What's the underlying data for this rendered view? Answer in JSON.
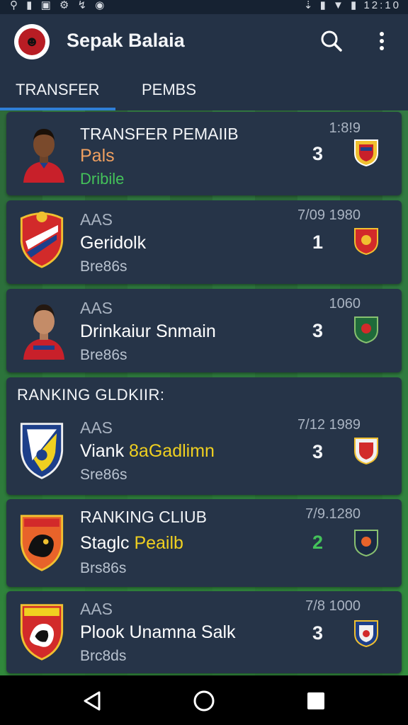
{
  "status_bar": {
    "left_icons": "⚲ ▮ ▣ ⚙ ↯ ◉",
    "right_icons": "⇣ ▮ ▼ ▮",
    "time": "12:10"
  },
  "app": {
    "title": "Sepak Balaia"
  },
  "tabs": [
    {
      "label": "TRANSFER"
    },
    {
      "label": "PEMBS"
    }
  ],
  "cards": [
    {
      "line1": "TRANSFER PEMAIIB",
      "line2": "Pals",
      "line3": "Dribile",
      "meta": "1:8!9",
      "score": "3"
    },
    {
      "line1": "AAS",
      "line2": "Geridolk",
      "line3": "Bre86s",
      "meta": "7/09 1980",
      "score": "1"
    },
    {
      "line1": "AAS",
      "line2": "Drinkaiur Snmain",
      "line3": "Bre86s",
      "meta": "1060",
      "score": "3"
    }
  ],
  "section": {
    "title": "RANKING GLDKIIR:"
  },
  "ranking_cards": [
    {
      "line1": "AAS",
      "line2": "Viank 8aGadlimn",
      "line3": "Sre86s",
      "meta": "7/12 1989",
      "score": "3"
    },
    {
      "line1": "RANKING CLIUB",
      "line2": "Staglc Peailb",
      "line3": "Brs86s",
      "meta": "7/9.1280",
      "score": "2"
    },
    {
      "line1": "AAS",
      "line2": "Plook Unamna Salk",
      "line3": "Brc8ds",
      "meta": "7/8 1000",
      "score": "3"
    }
  ],
  "colors": {
    "accent": "#2f7fd6",
    "green": "#44c25a",
    "yellow": "#f0d020",
    "orange": "#f0a060"
  }
}
